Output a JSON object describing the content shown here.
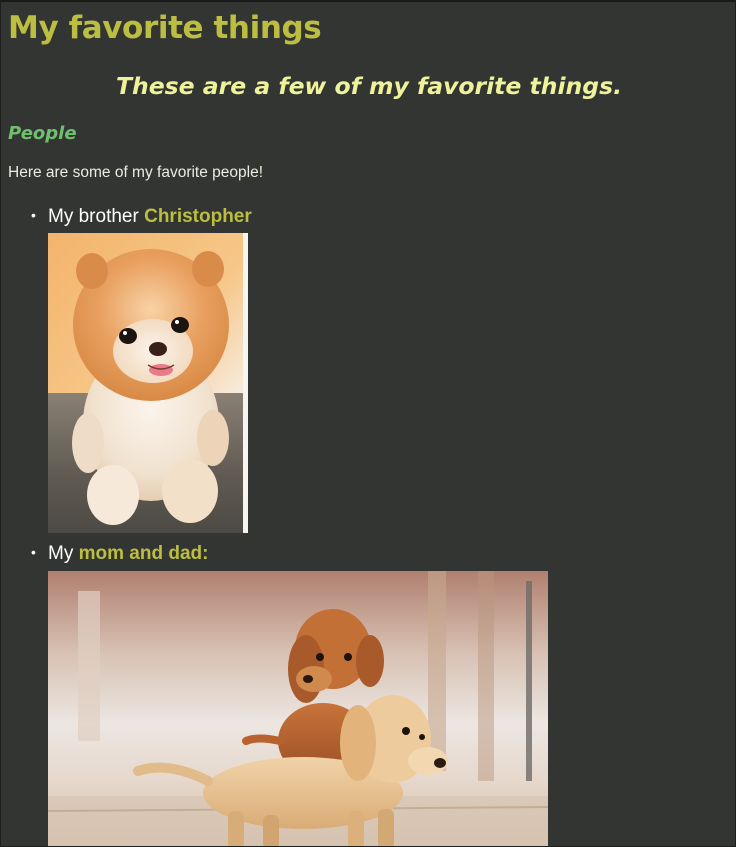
{
  "page": {
    "title": "My favorite things",
    "subtitle": "These are a few of my favorite things.",
    "section_heading": "People",
    "intro": "Here are some of my favorite people!"
  },
  "list": {
    "items": [
      {
        "bullet": "•",
        "prefix": "My brother ",
        "highlight": "Christopher",
        "photo": "pomeranian-puppy-photo"
      },
      {
        "bullet": "•",
        "prefix": "My ",
        "highlight": "mom and dad:",
        "photo": "dachshund-puppies-photo"
      }
    ]
  },
  "colors": {
    "background": "#333532",
    "title": "#bcbe41",
    "subtitle": "#eef29a",
    "section_heading": "#6fbf6f",
    "body_text": "#e8eee0",
    "list_text": "#ffffff",
    "highlight": "#bcbe41"
  }
}
